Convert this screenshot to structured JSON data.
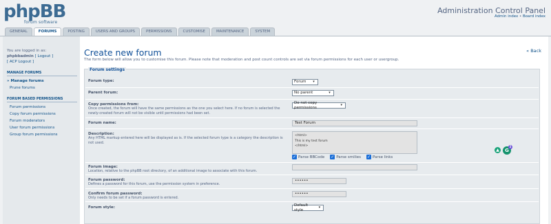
{
  "header": {
    "logo_text": "phpBB",
    "logo_tagline": "forum software",
    "title": "Administration Control Panel",
    "links": [
      "Admin index",
      "Board index"
    ],
    "link_separator": "•"
  },
  "tabs": [
    "GENERAL",
    "FORUMS",
    "POSTING",
    "USERS AND GROUPS",
    "PERMISSIONS",
    "CUSTOMISE",
    "MAINTENANCE",
    "SYSTEM"
  ],
  "active_tab": "FORUMS",
  "sidebar": {
    "logged_in_as": "You are logged in as:",
    "username": "phpbbadmin",
    "logout": "[ Logout ]",
    "acp_logout": "[ ACP Logout ]",
    "sections": [
      {
        "heading": "MANAGE FORUMS",
        "items": [
          "Manage forums",
          "Prune forums"
        ]
      },
      {
        "heading": "FORUM BASED PERMISSIONS",
        "items": [
          "Forum permissions",
          "Copy forum permissions",
          "Forum moderators",
          "User forum permissions",
          "Group forum permissions"
        ]
      }
    ]
  },
  "main": {
    "title": "Create new forum",
    "back": "« Back",
    "intro": "The form below will allow you to customise this forum. Please note that moderation and post count controls are set via forum permissions for each user or usergroup.",
    "legend": "Forum settings",
    "fields": {
      "forum_type": {
        "label": "Forum type:",
        "value": "Forum"
      },
      "parent_forum": {
        "label": "Parent forum:",
        "value": "No parent"
      },
      "copy_permissions": {
        "label": "Copy permissions from:",
        "desc": "Once created, the forum will have the same permissions as the one you select here. If no forum is selected the newly-created forum will not be visible until permissions had been set.",
        "value": "Do not copy permissions"
      },
      "forum_name": {
        "label": "Forum name:",
        "value": "Test Forum"
      },
      "description": {
        "label": "Description:",
        "desc": "Any HTML markup entered here will be displayed as is. If the selected forum type is a category the description is not used.",
        "lines": [
          "<html>",
          "This is my test forum",
          "</html>"
        ],
        "checks": [
          "Parse BBCode",
          "Parse smilies",
          "Parse links"
        ]
      },
      "forum_image": {
        "label": "Forum image:",
        "desc": "Location, relative to the phpBB root directory, of an additional image to associate with this forum.",
        "value": ""
      },
      "forum_password": {
        "label": "Forum password:",
        "desc": "Defines a password for this forum, use the permission system in preference.",
        "value": "••••••"
      },
      "confirm_password": {
        "label": "Confirm forum password:",
        "desc": "Only needs to be set if a forum password is entered.",
        "value": "••••••"
      },
      "forum_style": {
        "label": "Forum style:",
        "value": "Default style"
      }
    }
  },
  "widget_badge_count": "2",
  "colors": {
    "accent": "#105289",
    "title": "#115098",
    "panel_bg": "#e7ebee",
    "page_bg": "#eff1f3"
  }
}
